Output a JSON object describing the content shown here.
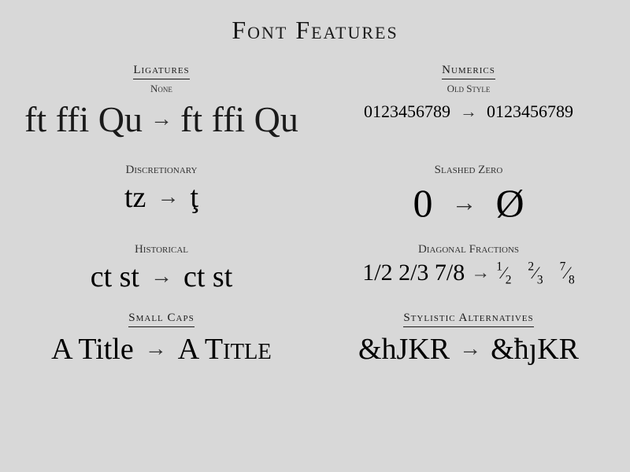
{
  "page": {
    "title": "Font Features",
    "sections": [
      {
        "id": "ligatures",
        "title": "Ligatures",
        "subtitle": "None",
        "before": "ft ffi Qu",
        "after": "ft ffi Qu"
      },
      {
        "id": "numerics",
        "title": "Numerics",
        "subtitle": "Old Style",
        "before": "0123456789",
        "after": "0123456789"
      },
      {
        "id": "discretionary",
        "title": "Discretionary",
        "before": "tz",
        "after": "ţ"
      },
      {
        "id": "slashed-zero",
        "title": "Slashed Zero",
        "before": "0",
        "after": "Ø"
      },
      {
        "id": "historical",
        "title": "Historical",
        "before": "ct st",
        "after": "ct st"
      },
      {
        "id": "diagonal-fractions",
        "title": "Diagonal Fractions",
        "before": "1/2 2/3 7/8",
        "after": "fractions"
      },
      {
        "id": "small-caps",
        "title": "Small Caps",
        "before": "A Title",
        "after": "A Title"
      },
      {
        "id": "stylistic-alternatives",
        "title": "Stylistic Alternatives",
        "before": "&hJKR",
        "after": "&ħĴKR"
      }
    ],
    "arrow": "→"
  }
}
